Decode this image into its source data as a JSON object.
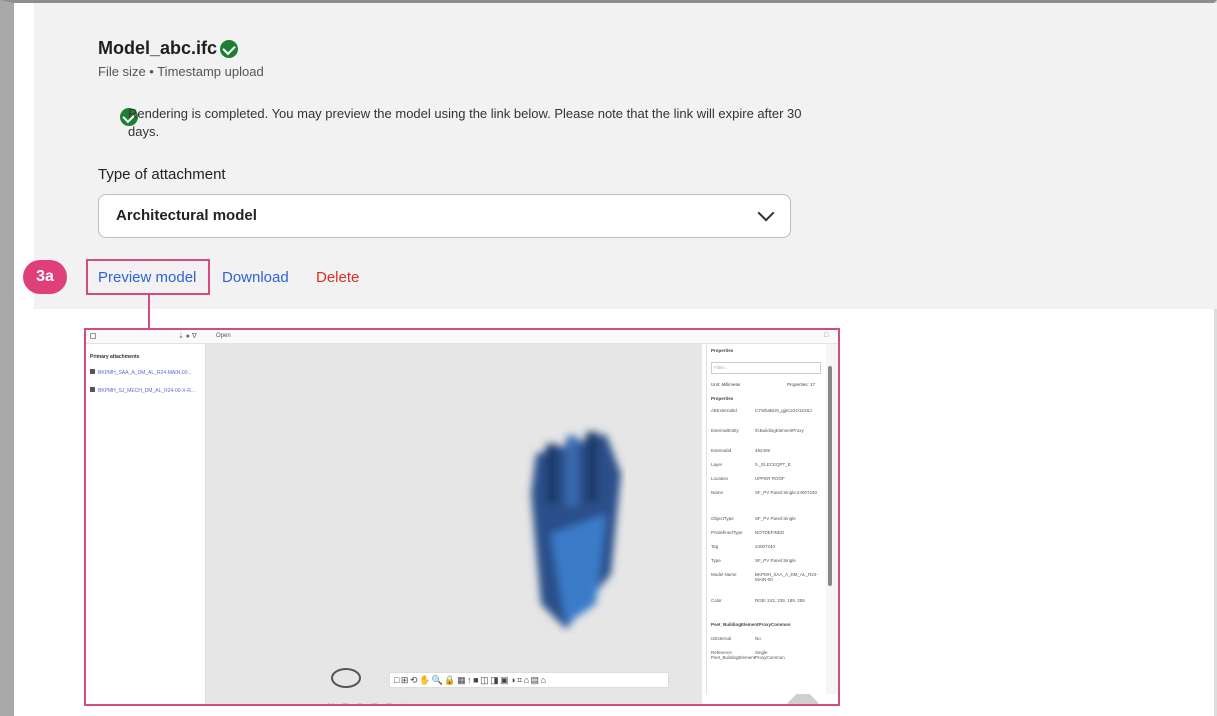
{
  "file": {
    "name": "Model_abc.ifc",
    "meta": "File size • Timestamp upload",
    "status_icon": "check-circle-icon"
  },
  "notice": {
    "text": "Rendering is completed. You may preview the model using the link below. Please note that the link will expire after 30 days."
  },
  "attachment": {
    "label": "Type of attachment",
    "selected": "Architectural model"
  },
  "actions": {
    "preview": "Preview model",
    "download": "Download",
    "delete": "Delete"
  },
  "callout": {
    "badge": "3a",
    "color": "#e0407a"
  },
  "viewer": {
    "top_bar_label": "Open",
    "left_panel": {
      "title": "Primary attachments",
      "items": [
        "BKPMH_SAA_A_DM_AL_R24-MAIN-00...",
        "BKPMH_SJ_MECH_DM_AL_R24-00-X-R..."
      ]
    },
    "properties_panel": {
      "title": "Properties",
      "filter_placeholder": "Filter...",
      "unit": "Unit: Millimeter",
      "count_label": "Properties: 17",
      "section1": "Properties",
      "rows": [
        {
          "k": "AttExternalId",
          "v": "C7WbaBU9_gjpCe2O1Dz6J"
        },
        {
          "k": "ExternalEntity",
          "v": "IfcBuildingElementProxy"
        },
        {
          "k": "ExternalId",
          "v": "482409"
        },
        {
          "k": "Layer",
          "v": "0._ELECEQPT_E"
        },
        {
          "k": "Location",
          "v": "UPPER ROOF"
        },
        {
          "k": "Name",
          "v": "SF_PV Panel:Single:24007240"
        },
        {
          "k": "ObjectType",
          "v": "SF_PV Panel:Single"
        },
        {
          "k": "PredefinedType",
          "v": "NOTDEFINED"
        },
        {
          "k": "Tag",
          "v": "24007240"
        },
        {
          "k": "Type",
          "v": "SF_PV Panel:Single"
        },
        {
          "k": "Model Name",
          "v": "BKPMH_SAA_A_DM_AL_R24-MAIN-00"
        },
        {
          "k": "Color",
          "v": "RGB: 242, 239, 189, 255"
        }
      ],
      "section2": "Pset_BuildingElementProxyCommon",
      "rows2": [
        {
          "k": "IsExternal",
          "v": "No"
        },
        {
          "k": "Reference Pset_BuildingElementProxyCommon",
          "v": "Single"
        }
      ]
    },
    "toolbar_glyphs": "□⊞⟲✋🔍🔒▦↑■◫◨▣◑⌗⌂▤⌂",
    "bottom_glyphs": "⛶ ▦ ▢ ▤ ▦ ✕"
  }
}
